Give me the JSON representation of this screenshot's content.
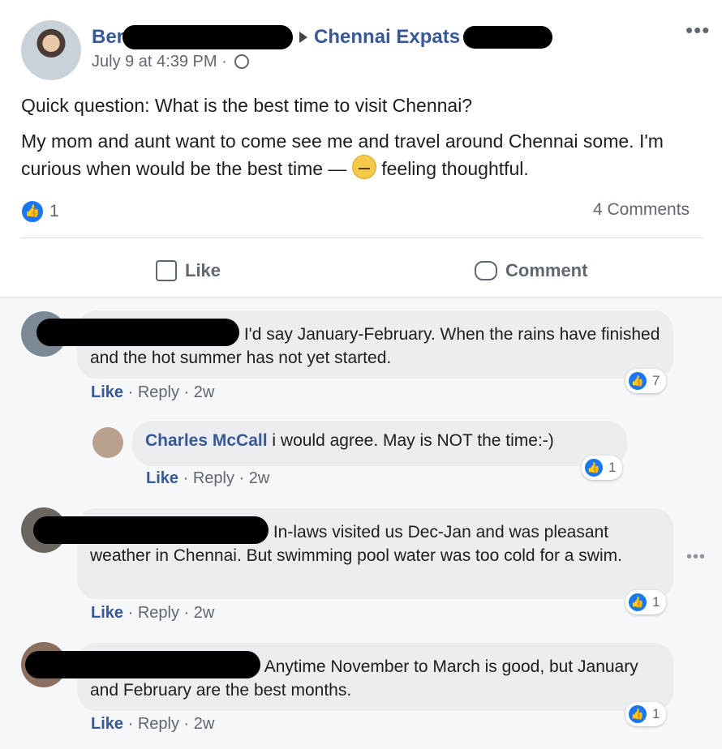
{
  "post": {
    "author_visible": "Ber",
    "group_name": "Chennai Expats",
    "timestamp": "July 9 at 4:39 PM ·",
    "question": "Quick question: What is the best time to visit Chennai?",
    "body_text": "My mom and aunt want to come see me and travel around Chennai some. I'm curious when would be the best time —",
    "feeling": "feeling thoughtful.",
    "like_count": "1",
    "comments_label": "4 Comments",
    "more_glyph": "•••"
  },
  "actions": {
    "like": "Like",
    "comment": "Comment"
  },
  "comments": [
    {
      "name": "",
      "text": "I'd say January-February. When the rains have finished and the hot summer has not yet started.",
      "like": "Like",
      "reply": "Reply",
      "time": "2w",
      "reactions": "7"
    },
    {
      "name": "Charles McCall",
      "text": "i would agree. May is NOT the time:-)",
      "like": "Like",
      "reply": "Reply",
      "time": "2w",
      "reactions": "1"
    },
    {
      "name": "",
      "text": "In-laws visited us Dec-Jan and was pleasant weather in Chennai. But swimming pool water was too cold for a swim.",
      "like": "Like",
      "reply": "Reply",
      "time": "2w",
      "reactions": "1"
    },
    {
      "name": "",
      "text": "Anytime November to March is good, but January and February are the best months.",
      "like": "Like",
      "reply": "Reply",
      "time": "2w",
      "reactions": "1"
    }
  ],
  "separator": "·",
  "comment_more_glyph": "•••",
  "icons": {
    "like_badge": "👍",
    "globe": "globe-icon"
  },
  "colors": {
    "link": "#385898",
    "like_blue": "#1877f2",
    "bubble": "#ebedf0"
  }
}
